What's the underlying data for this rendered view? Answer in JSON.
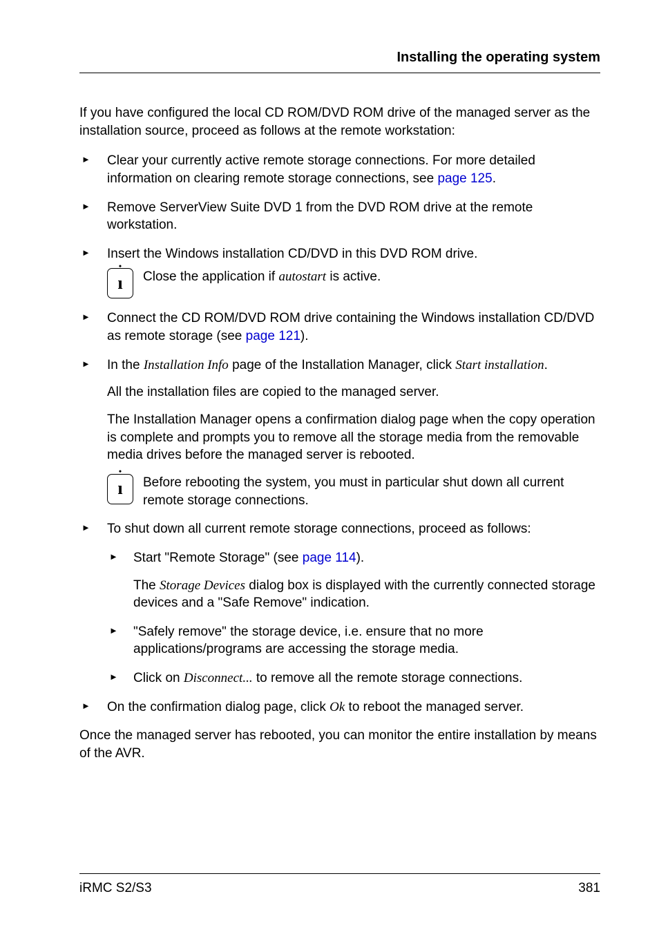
{
  "header": {
    "title": "Installing the operating system"
  },
  "intro": "If you have configured the local CD ROM/DVD ROM drive of the managed server as the installation source, proceed as follows at the remote workstation:",
  "bullets": {
    "b1_pre": "Clear your currently active remote storage connections. For more detailed information on clearing remote storage connections, see ",
    "b1_link": "page 125",
    "b1_post": ".",
    "b2": "Remove ServerView Suite DVD 1 from the DVD ROM drive at the remote workstation.",
    "b3": "Insert the Windows installation CD/DVD in this DVD ROM drive.",
    "b3_info_pre": "Close the application if ",
    "b3_info_italic": "autostart",
    "b3_info_post": " is active.",
    "b4_pre": "Connect the CD ROM/DVD ROM drive containing the Windows installation CD/DVD as remote storage (see ",
    "b4_link": "page 121",
    "b4_post": ").",
    "b5_pre": " In the ",
    "b5_italic1": "Installation Info",
    "b5_mid": " page of the Installation Manager, click ",
    "b5_italic2": "Start installation",
    "b5_post": ".",
    "b5_sub1": "All the installation files are copied to the managed server.",
    "b5_sub2": "The Installation Manager opens a confirmation dialog page when the copy operation is complete and prompts you to remove all the storage media from the removable media drives before the managed server is rebooted.",
    "b5_info": "Before rebooting the system, you must in particular shut down all current remote storage connections.",
    "b6": "To shut down all current remote storage connections, proceed as follows:",
    "b6_s1_pre": "Start \"Remote Storage\" (see ",
    "b6_s1_link": "page 114",
    "b6_s1_post": ").",
    "b6_s1_sub_pre": "The ",
    "b6_s1_sub_italic": "Storage Devices",
    "b6_s1_sub_post": " dialog box is displayed with the currently connected storage devices and a \"Safe Remove\" indication.",
    "b6_s2": "\"Safely remove\" the storage device, i.e. ensure that no more applications/programs are accessing the storage media.",
    "b6_s3_pre": "Click on ",
    "b6_s3_italic": "Disconnect...",
    "b6_s3_post": " to remove all the remote storage connections.",
    "b7_pre": "On the confirmation dialog page, click ",
    "b7_italic": "Ok",
    "b7_post": " to reboot the managed server."
  },
  "closing": "Once the managed server has rebooted, you can monitor the entire installation by means of the AVR.",
  "footer": {
    "left": "iRMC S2/S3",
    "right": "381"
  }
}
